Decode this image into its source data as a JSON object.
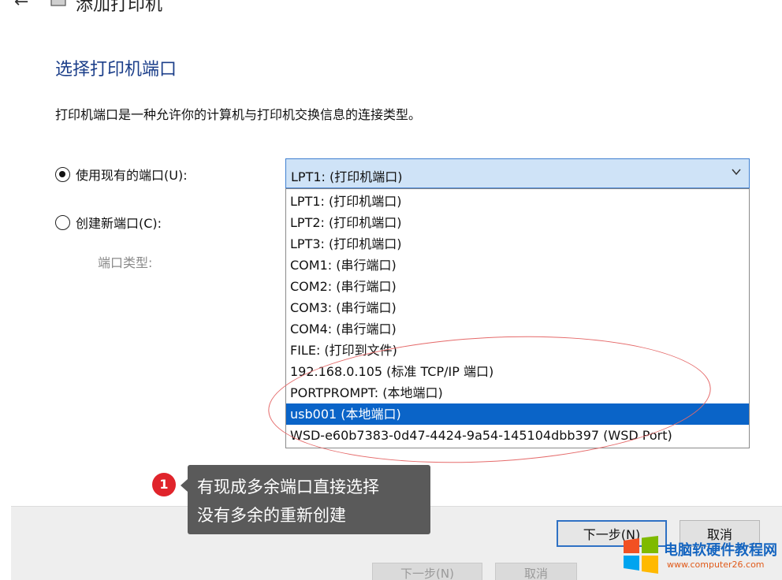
{
  "window": {
    "title": "添加打印机"
  },
  "page": {
    "heading": "选择打印机端口",
    "description": "打印机端口是一种允许你的计算机与打印机交换信息的连接类型。"
  },
  "options": {
    "use_existing_label": "使用现有的端口(U):",
    "create_new_label": "创建新端口(C):",
    "port_type_label": "端口类型:"
  },
  "port_select": {
    "selected_value": "LPT1: (打印机端口)",
    "items": [
      "LPT1: (打印机端口)",
      "LPT2: (打印机端口)",
      "LPT3: (打印机端口)",
      "COM1: (串行端口)",
      "COM2: (串行端口)",
      "COM3: (串行端口)",
      "COM4: (串行端口)",
      "FILE: (打印到文件)",
      "192.168.0.105 (标准 TCP/IP 端口)",
      "PORTPROMPT: (本地端口)",
      "usb001 (本地端口)",
      "WSD-e60b7383-0d47-4424-9a54-145104dbb397 (WSD Port)"
    ],
    "highlighted_index": 10
  },
  "footer": {
    "next_label": "下一步(N)",
    "cancel_label": "取消"
  },
  "annotation": {
    "number": "1",
    "line1": "有现成多余端口直接选择",
    "line2": "没有多余的重新创建"
  },
  "watermark": {
    "title": "电脑软硬件教程网",
    "url": "www.computer26.com"
  },
  "colors": {
    "accent": "#0a64c8",
    "heading": "#1c3f8a",
    "annotation_red": "#e0242b"
  }
}
